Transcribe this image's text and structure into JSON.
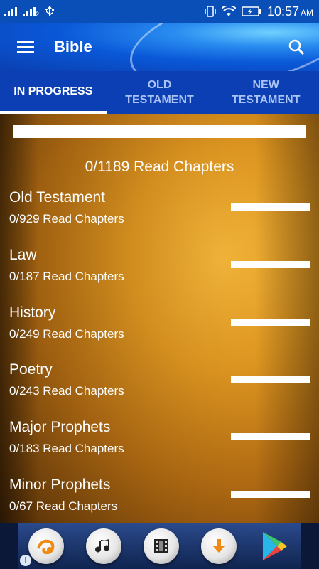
{
  "status_bar": {
    "time": "10:57",
    "ampm": "AM",
    "sim2_label": "2"
  },
  "app_bar": {
    "title": "Bible"
  },
  "tabs": [
    {
      "label": "IN PROGRESS",
      "active": true
    },
    {
      "label": "OLD\nTESTAMENT",
      "active": false
    },
    {
      "label": "NEW\nTESTAMENT",
      "active": false
    }
  ],
  "summary": {
    "total_text": "0/1189 Read Chapters",
    "progress": 0
  },
  "categories": [
    {
      "name": "Old Testament",
      "count": "0/929 Read Chapters",
      "progress": 0
    },
    {
      "name": "Law",
      "count": "0/187 Read Chapters",
      "progress": 0
    },
    {
      "name": "History",
      "count": "0/249 Read Chapters",
      "progress": 0
    },
    {
      "name": "Poetry",
      "count": "0/243 Read Chapters",
      "progress": 0
    },
    {
      "name": "Major Prophets",
      "count": "0/183 Read Chapters",
      "progress": 0
    },
    {
      "name": "Minor Prophets",
      "count": "0/67 Read Chapters",
      "progress": 0
    }
  ],
  "ad_bar": {
    "icons": [
      "uc-browser-icon",
      "music-note-icon",
      "video-film-icon",
      "download-arrow-icon",
      "play-store-icon"
    ],
    "info_label": "i"
  },
  "colors": {
    "primary": "#0b3fb3",
    "accent": "#ffffff"
  }
}
